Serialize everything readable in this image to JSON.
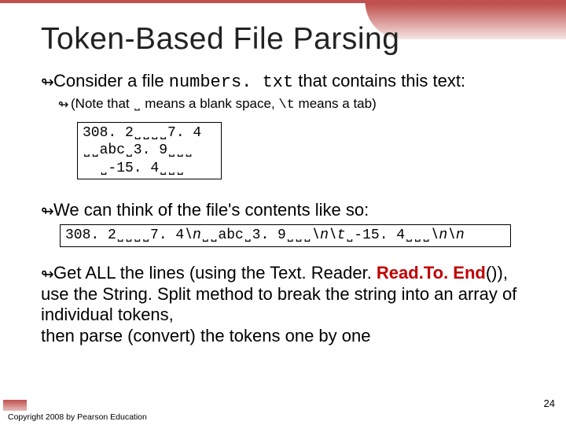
{
  "title": "Token-Based File Parsing",
  "bullet1_pre": "Consider a file ",
  "bullet1_mono": "numbers. txt",
  "bullet1_post": " that contains this text:",
  "note_pre": "(Note that ",
  "note_mark": "˽",
  "note_mid1": " means a blank space, ",
  "note_esc": "\\t",
  "note_mid2": " means a tab)",
  "code_box1": "308. 2˽˽˽˽7. 4\n˽˽abc˽3. 9˽˽˽\n  ˽-15. 4˽˽˽",
  "bullet2": "We can think of the file's contents like so:",
  "code_line_1": "308. 2˽˽˽˽7. 4",
  "code_line_2": "\\n",
  "code_line_3": "˽˽abc˽3. 9˽˽˽",
  "code_line_4": "\\n\\t",
  "code_line_5": "˽-15. 4˽˽˽",
  "code_line_6": "\\n\\n",
  "bullet3_pre": "Get ALL the lines (using the Text. Reader. ",
  "bullet3_red": "Read.To. End",
  "bullet3_mid": "()),\nuse the String. Split method to break the string into an array of individual tokens,\nthen parse (convert) the tokens one by one",
  "copyright": "Copyright 2008 by Pearson Education",
  "page": "24"
}
